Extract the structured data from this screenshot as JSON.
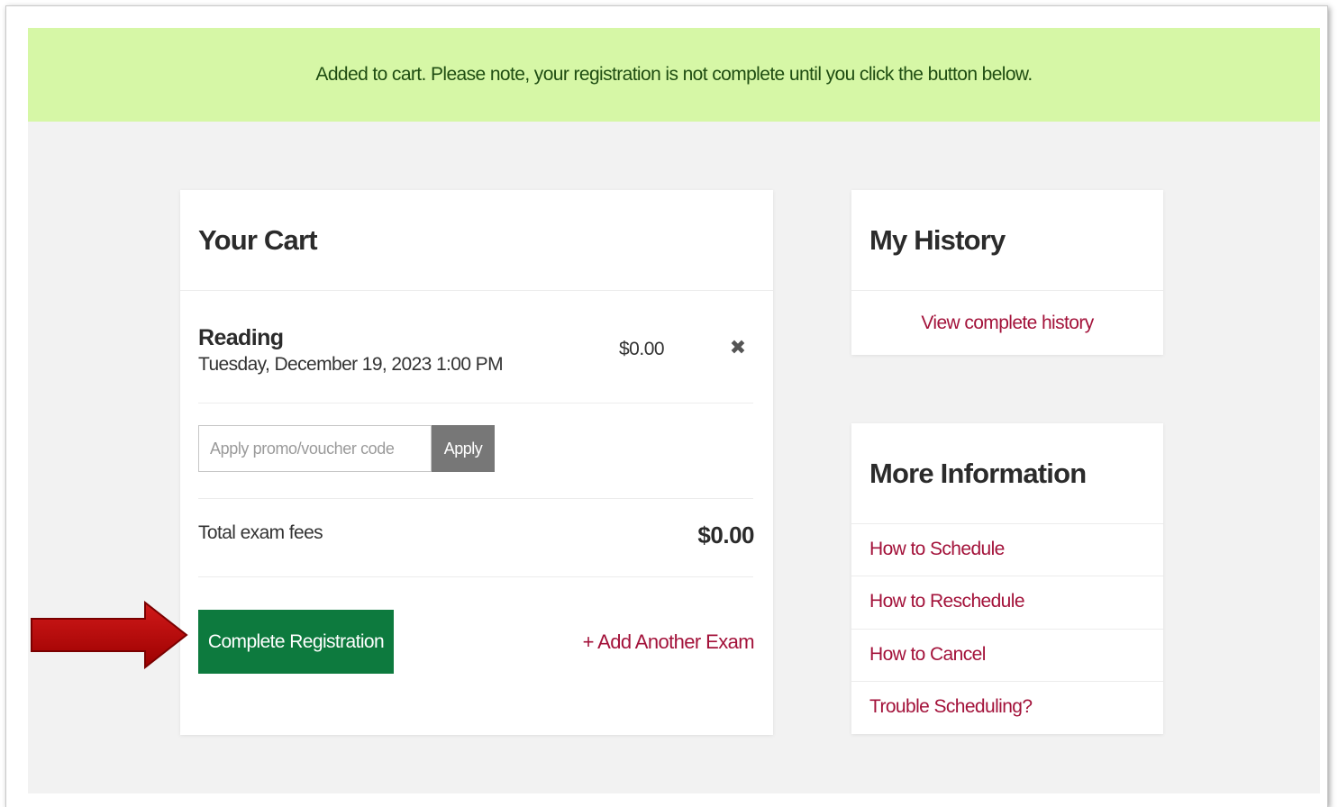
{
  "colors": {
    "banner_bg": "#d6f7a6",
    "primary_button": "#0d7a3e",
    "link": "#a3123a",
    "arrow": "#c00000"
  },
  "banner": {
    "message": "Added to cart. Please note, your registration is not complete until you click the button below."
  },
  "cart": {
    "title": "Your Cart",
    "item": {
      "name": "Reading",
      "datetime": "Tuesday, December 19, 2023 1:00 PM",
      "price": "$0.00",
      "remove_icon": "close-icon"
    },
    "promo": {
      "placeholder": "Apply promo/voucher code",
      "value": "",
      "button_label": "Apply"
    },
    "total": {
      "label": "Total exam fees",
      "value": "$0.00"
    },
    "complete_button_label": "Complete Registration",
    "add_exam_label": "+ Add Another Exam"
  },
  "history": {
    "title": "My History",
    "link_label": "View complete history"
  },
  "more_info": {
    "title": "More Information",
    "links": [
      {
        "label": "How to Schedule"
      },
      {
        "label": "How to Reschedule"
      },
      {
        "label": "How to Cancel"
      },
      {
        "label": "Trouble Scheduling?"
      }
    ]
  },
  "annotation": {
    "icon": "arrow-right-icon"
  }
}
